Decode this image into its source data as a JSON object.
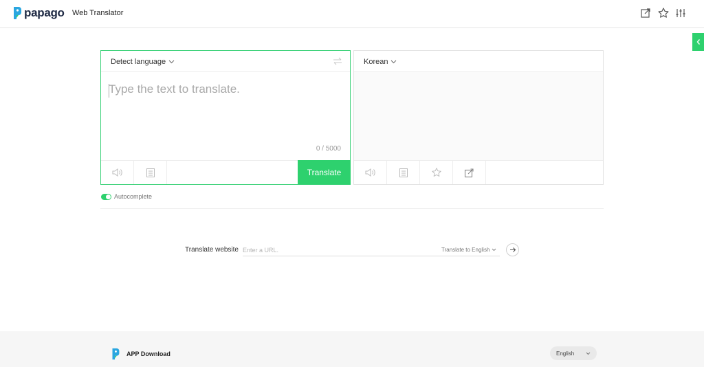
{
  "header": {
    "logo_text": "papago",
    "title": "Web Translator",
    "icons": [
      "external-link-icon",
      "star-icon",
      "settings-sliders-icon"
    ]
  },
  "side_tab": {
    "icon": "chevron-left-icon"
  },
  "source": {
    "language": "Detect language",
    "placeholder": "Type the text to translate.",
    "value": "",
    "counter": "0 / 5000",
    "translate_label": "Translate",
    "footer_icons": [
      "speaker-icon",
      "dictionary-icon"
    ]
  },
  "target": {
    "language": "Korean",
    "footer_icons": [
      "speaker-icon",
      "dictionary-icon",
      "star-icon",
      "share-icon"
    ]
  },
  "autocomplete": {
    "label": "Autocomplete",
    "enabled": true
  },
  "website": {
    "label": "Translate website",
    "placeholder": "Enter a URL.",
    "target_label": "Translate to English"
  },
  "footer": {
    "app_download": "APP Download",
    "language": "English"
  },
  "colors": {
    "accent": "#2ed16e",
    "border": "#e3e3e3"
  }
}
